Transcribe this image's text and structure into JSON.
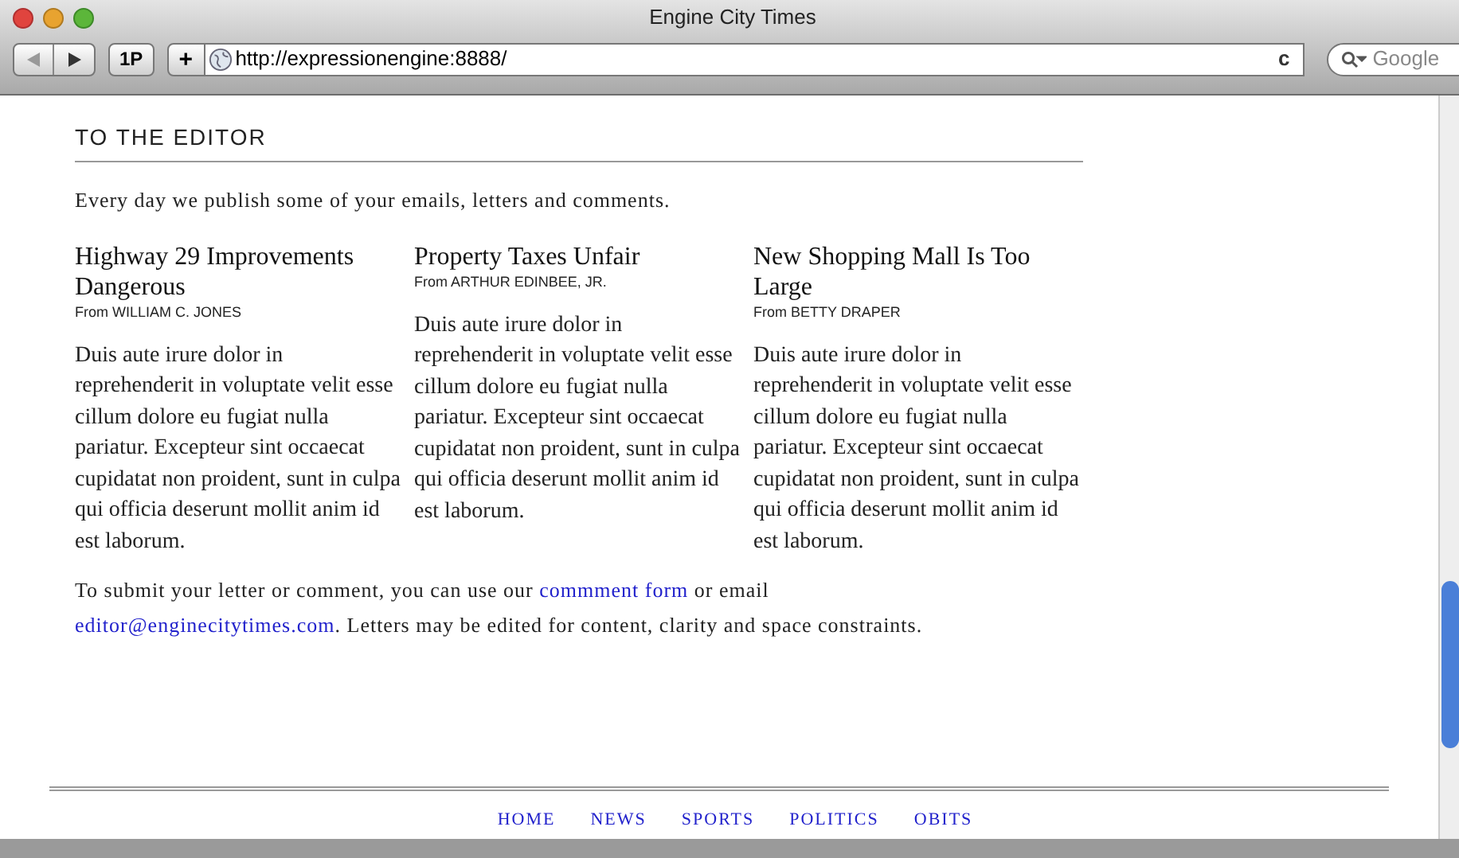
{
  "window": {
    "title": "Engine City Times"
  },
  "toolbar": {
    "bookmark_button": "1P",
    "add_button": "+",
    "url": "http://expressionengine:8888/",
    "reload": "c",
    "search_placeholder": "Google"
  },
  "section_title": "TO THE EDITOR",
  "intro": "Every day we publish some of your emails, letters and comments.",
  "letters": [
    {
      "title": "Highway 29 Improvements Dangerous",
      "from": "From WILLIAM C. JONES",
      "body": "Duis aute irure dolor in reprehenderit in voluptate velit esse cillum dolore eu fugiat nulla pariatur. Excepteur sint occaecat cupidatat non proident, sunt in culpa qui officia deserunt mollit anim id est laborum."
    },
    {
      "title": "Property Taxes Unfair",
      "from": "From ARTHUR EDINBEE, JR.",
      "body": "Duis aute irure dolor in reprehenderit in voluptate velit esse cillum dolore eu fugiat nulla pariatur. Excepteur sint occaecat cupidatat non proident, sunt in culpa qui officia deserunt mollit anim id est laborum."
    },
    {
      "title": "New Shopping Mall Is Too Large",
      "from": "From BETTY DRAPER",
      "body": "Duis aute irure dolor in reprehenderit in voluptate velit esse cillum dolore eu fugiat nulla pariatur. Excepteur sint occaecat cupidatat non proident, sunt in culpa qui officia deserunt mollit anim id est laborum."
    }
  ],
  "submit_note": [
    {
      "kind": "text",
      "text": "To submit your letter or comment, you can use our "
    },
    {
      "kind": "link",
      "text": "commment form"
    },
    {
      "kind": "text",
      "text": " or email "
    },
    {
      "kind": "link",
      "text": "editor@enginecitytimes.com"
    },
    {
      "kind": "text",
      "text": ". Letters may be edited for content, clarity and space constraints."
    }
  ],
  "footer_nav": [
    "HOME",
    "NEWS",
    "SPORTS",
    "POLITICS",
    "OBITS"
  ]
}
